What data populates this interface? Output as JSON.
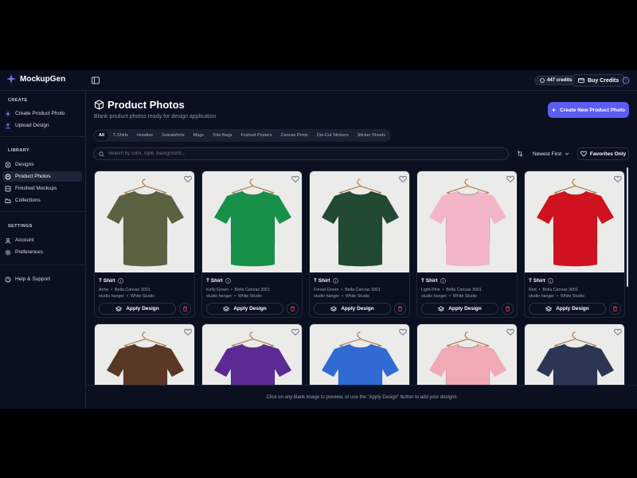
{
  "app": {
    "name": "MockupGen",
    "credits": "447 credits",
    "buy_label": "Buy Credits"
  },
  "sidebar": {
    "create_heading": "CREATE",
    "create_items": [
      {
        "label": "Create Product Photo",
        "icon": "sparkle-icon"
      },
      {
        "label": "Upload Design",
        "icon": "upload-icon"
      }
    ],
    "library_heading": "LIBRARY",
    "library_items": [
      {
        "label": "Designs",
        "icon": "designs-icon"
      },
      {
        "label": "Product Photos",
        "icon": "photos-icon",
        "active": true
      },
      {
        "label": "Finished Mockups",
        "icon": "mockups-icon"
      },
      {
        "label": "Collections",
        "icon": "folder-icon"
      }
    ],
    "settings_heading": "SETTINGS",
    "settings_items": [
      {
        "label": "Account",
        "icon": "user-icon"
      },
      {
        "label": "Preferences",
        "icon": "gear-icon"
      }
    ],
    "help_label": "Help & Support"
  },
  "main": {
    "title": "Product Photos",
    "subtitle": "Blank product photos ready for design application",
    "create_button": "Create New Product Photo",
    "tabs": [
      "All",
      "T-Shirts",
      "Hoodies",
      "Sweatshirts",
      "Mugs",
      "Tote Bags",
      "Framed Posters",
      "Canvas Prints",
      "Die-Cut Stickers",
      "Sticker Sheets"
    ],
    "active_tab": "All",
    "search_placeholder": "Search by color, style, background...",
    "sort_label": "Newest First",
    "favorites_label": "Favorites Only",
    "apply_label": "Apply Design",
    "footer_hint": "Click on any blank image to preview, or use the \"Apply Design\" button to add your designs"
  },
  "products": [
    {
      "title": "T Shirt",
      "color_name": "Army",
      "model": "Bella Canvas 3001",
      "style": "studio hanger",
      "background": "White Studio",
      "shirt_color": "#5b6141"
    },
    {
      "title": "T Shirt",
      "color_name": "Kelly-Green",
      "model": "Bella Canvas 3001",
      "style": "studio hanger",
      "background": "White Studio",
      "shirt_color": "#17904a"
    },
    {
      "title": "T Shirt",
      "color_name": "Forest-Green",
      "model": "Bella Canvas 3001",
      "style": "studio hanger",
      "background": "White Studio",
      "shirt_color": "#224a33"
    },
    {
      "title": "T Shirt",
      "color_name": "Light-Pink",
      "model": "Bella Canvas 3001",
      "style": "studio hanger",
      "background": "White Studio",
      "shirt_color": "#f2b6c6"
    },
    {
      "title": "T Shirt",
      "color_name": "Red",
      "model": "Bella Canvas 3001",
      "style": "studio hanger",
      "background": "White Studio",
      "shirt_color": "#d0121f"
    },
    {
      "shirt_color": "#5a3826"
    },
    {
      "shirt_color": "#5b2a94"
    },
    {
      "shirt_color": "#2f6bd2"
    },
    {
      "shirt_color": "#f1a9b5"
    },
    {
      "shirt_color": "#2b3652"
    }
  ]
}
